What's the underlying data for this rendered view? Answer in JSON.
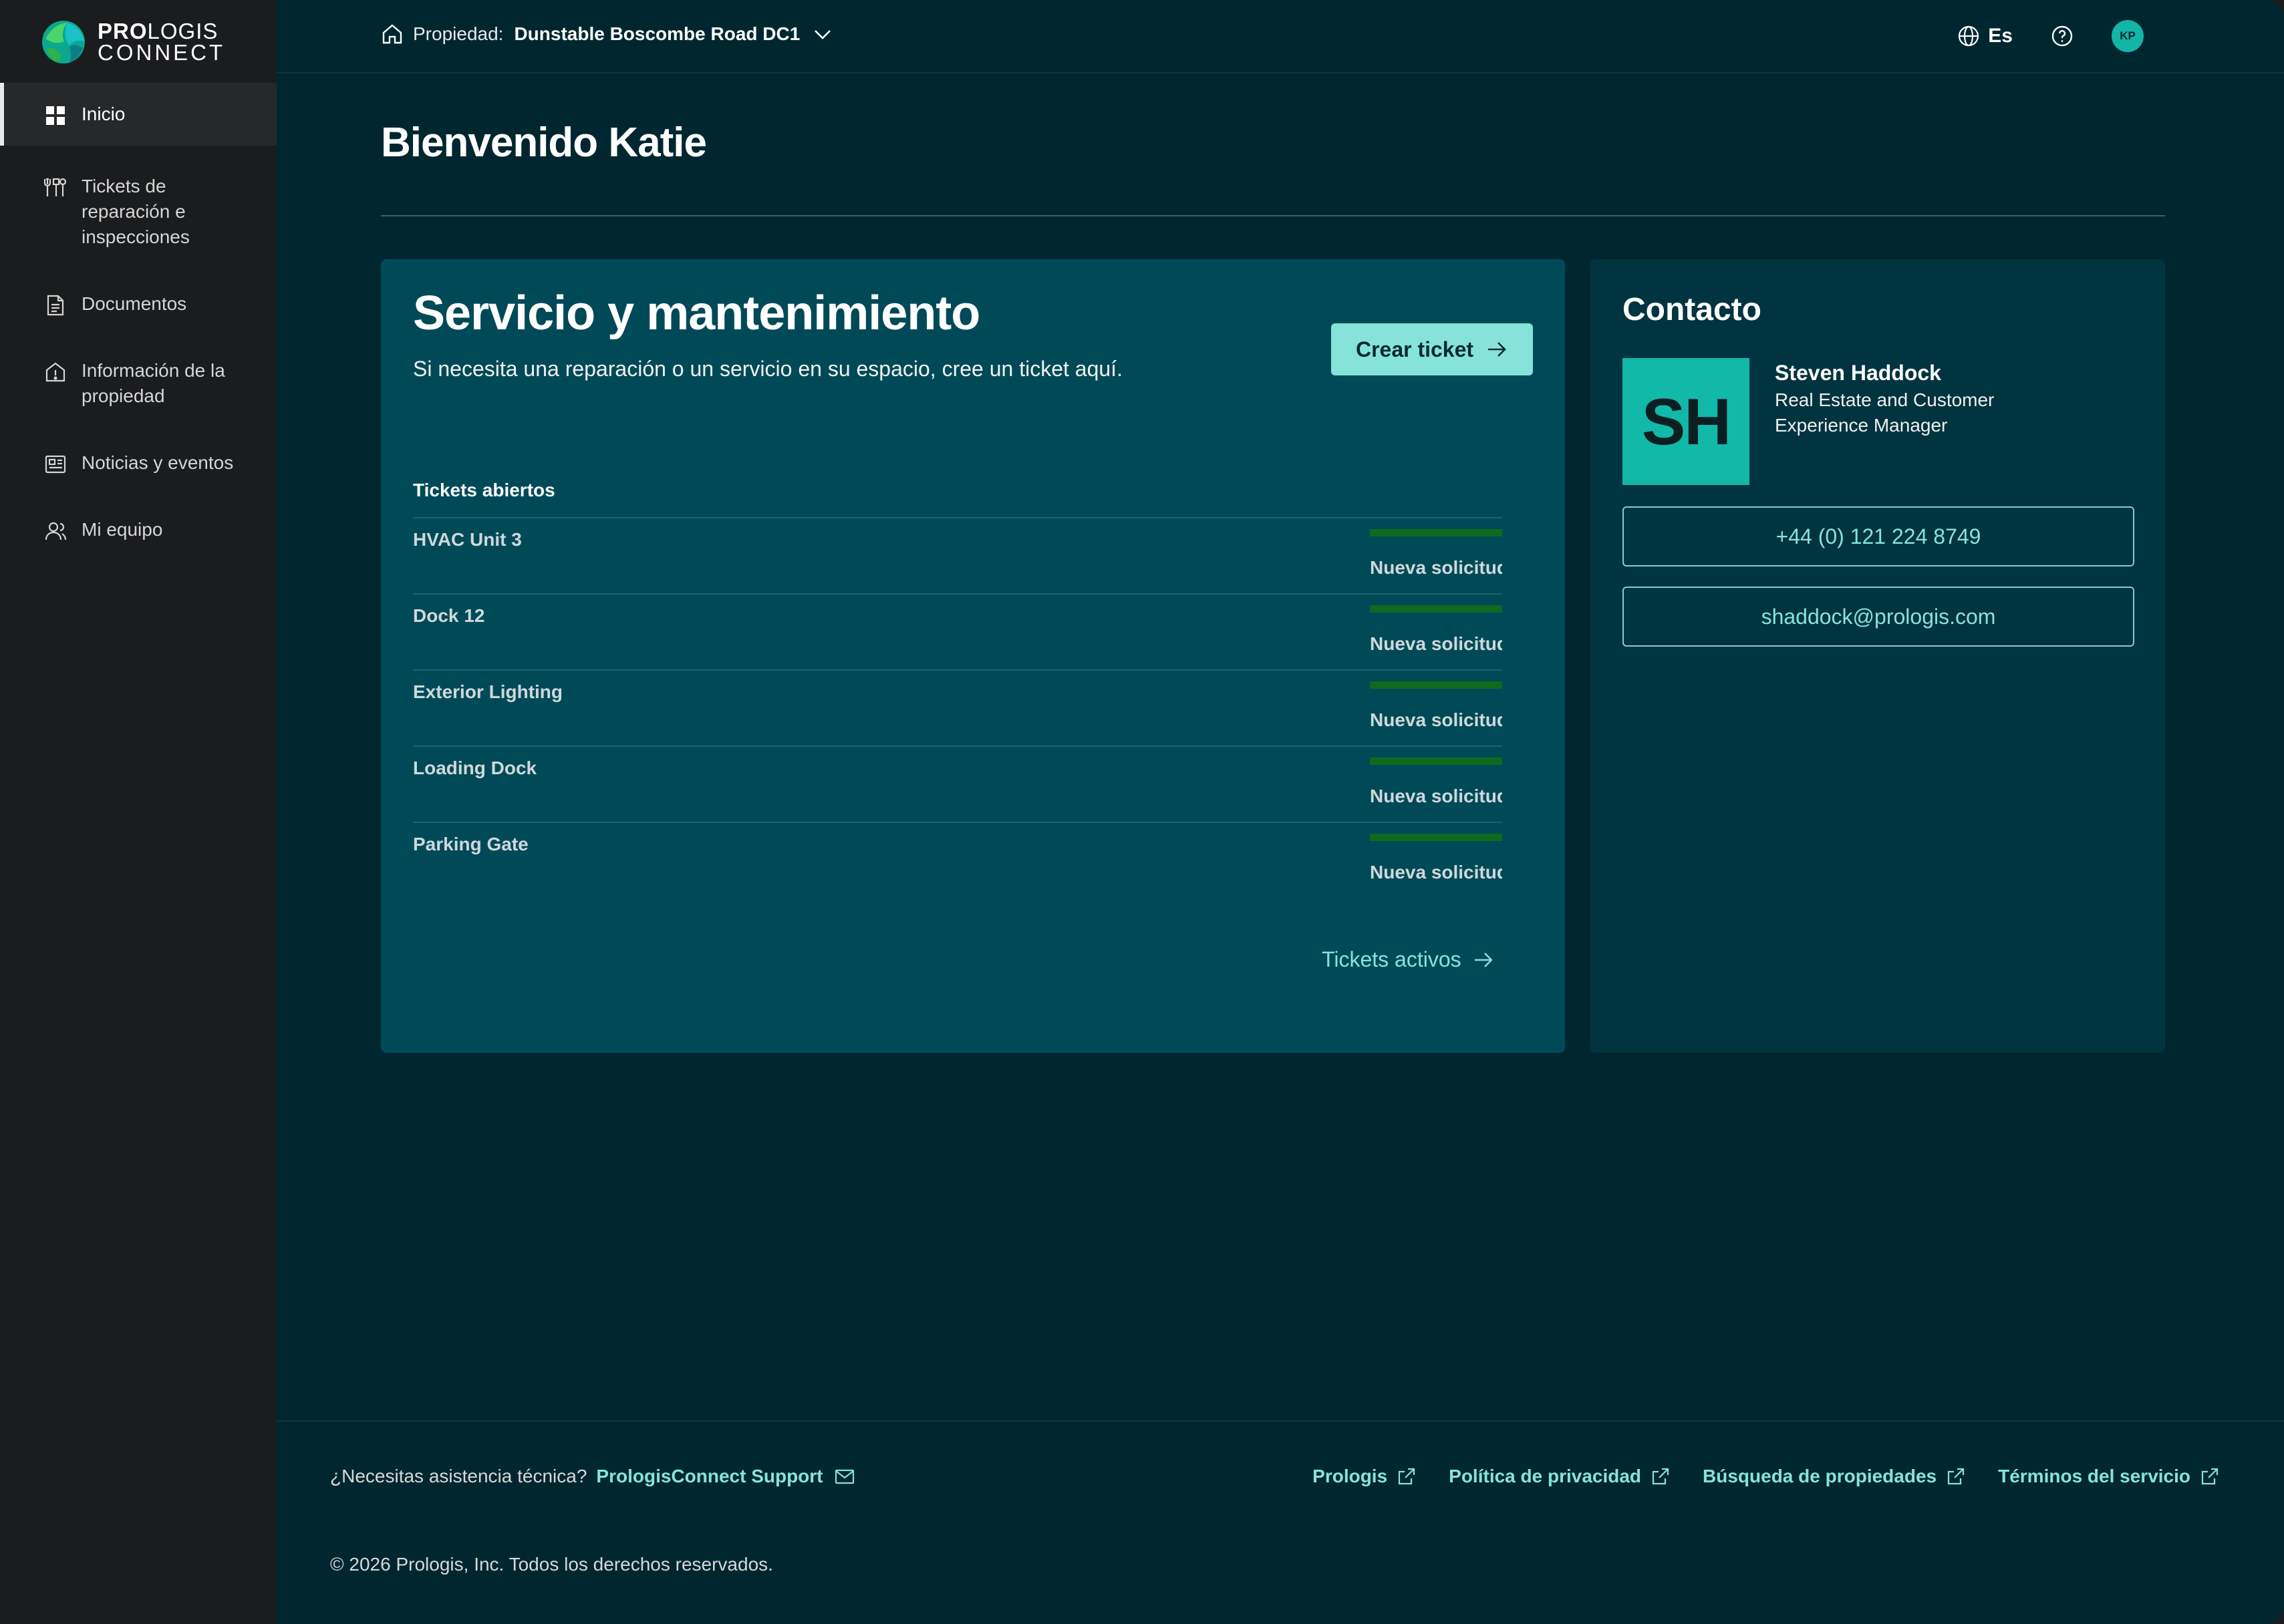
{
  "brand": {
    "name_bold": "PRO",
    "name_rest": "LOGIS",
    "line2": "CONNECT"
  },
  "sidebar": {
    "items": [
      {
        "label": "Inicio",
        "icon": "grid-icon",
        "active": true
      },
      {
        "label": "Tickets de reparación e inspecciones",
        "icon": "tools-icon"
      },
      {
        "label": "Documentos",
        "icon": "document-icon"
      },
      {
        "label": "Información de la propiedad",
        "icon": "building-info-icon"
      },
      {
        "label": "Noticias y eventos",
        "icon": "newspaper-icon"
      },
      {
        "label": "Mi equipo",
        "icon": "team-icon"
      }
    ]
  },
  "header": {
    "property_label": "Propiedad:",
    "property_value": "Dunstable Boscombe Road DC1",
    "language": "Es",
    "user_initials": "KP"
  },
  "welcome": "Bienvenido Katie",
  "service": {
    "title": "Servicio y mantenimiento",
    "subtitle": "Si necesita una reparación o un servicio en su espacio, cree un ticket aquí.",
    "create_button": "Crear ticket",
    "open_tickets_heading": "Tickets abiertos",
    "tickets": [
      {
        "name": "HVAC Unit 3",
        "status": "Nueva solicitud"
      },
      {
        "name": "Dock 12",
        "status": "Nueva solicitud"
      },
      {
        "name": "Exterior Lighting",
        "status": "Nueva solicitud"
      },
      {
        "name": "Loading Dock",
        "status": "Nueva solicitud"
      },
      {
        "name": "Parking Gate",
        "status": "Nueva solicitud"
      }
    ],
    "active_link": "Tickets activos"
  },
  "contact": {
    "title": "Contacto",
    "initials": "SH",
    "name": "Steven Haddock",
    "role": "Real Estate and Customer Experience Manager",
    "phone": "+44 (0) 121 224 8749",
    "email": "shaddock@prologis.com"
  },
  "footer": {
    "help_text": "¿Necesitas asistencia técnica?",
    "support_link": "PrologisConnect Support",
    "links": [
      "Prologis",
      "Política de privacidad",
      "Búsqueda de propiedades",
      "Términos del servicio"
    ],
    "copyright": "© 2026 Prologis, Inc. Todos los derechos reservados."
  },
  "colors": {
    "accent": "#86e3d9",
    "background": "#002730",
    "sidebar": "#1b1c1e",
    "card": "#004a58",
    "status_bar": "#0f6a1e"
  }
}
